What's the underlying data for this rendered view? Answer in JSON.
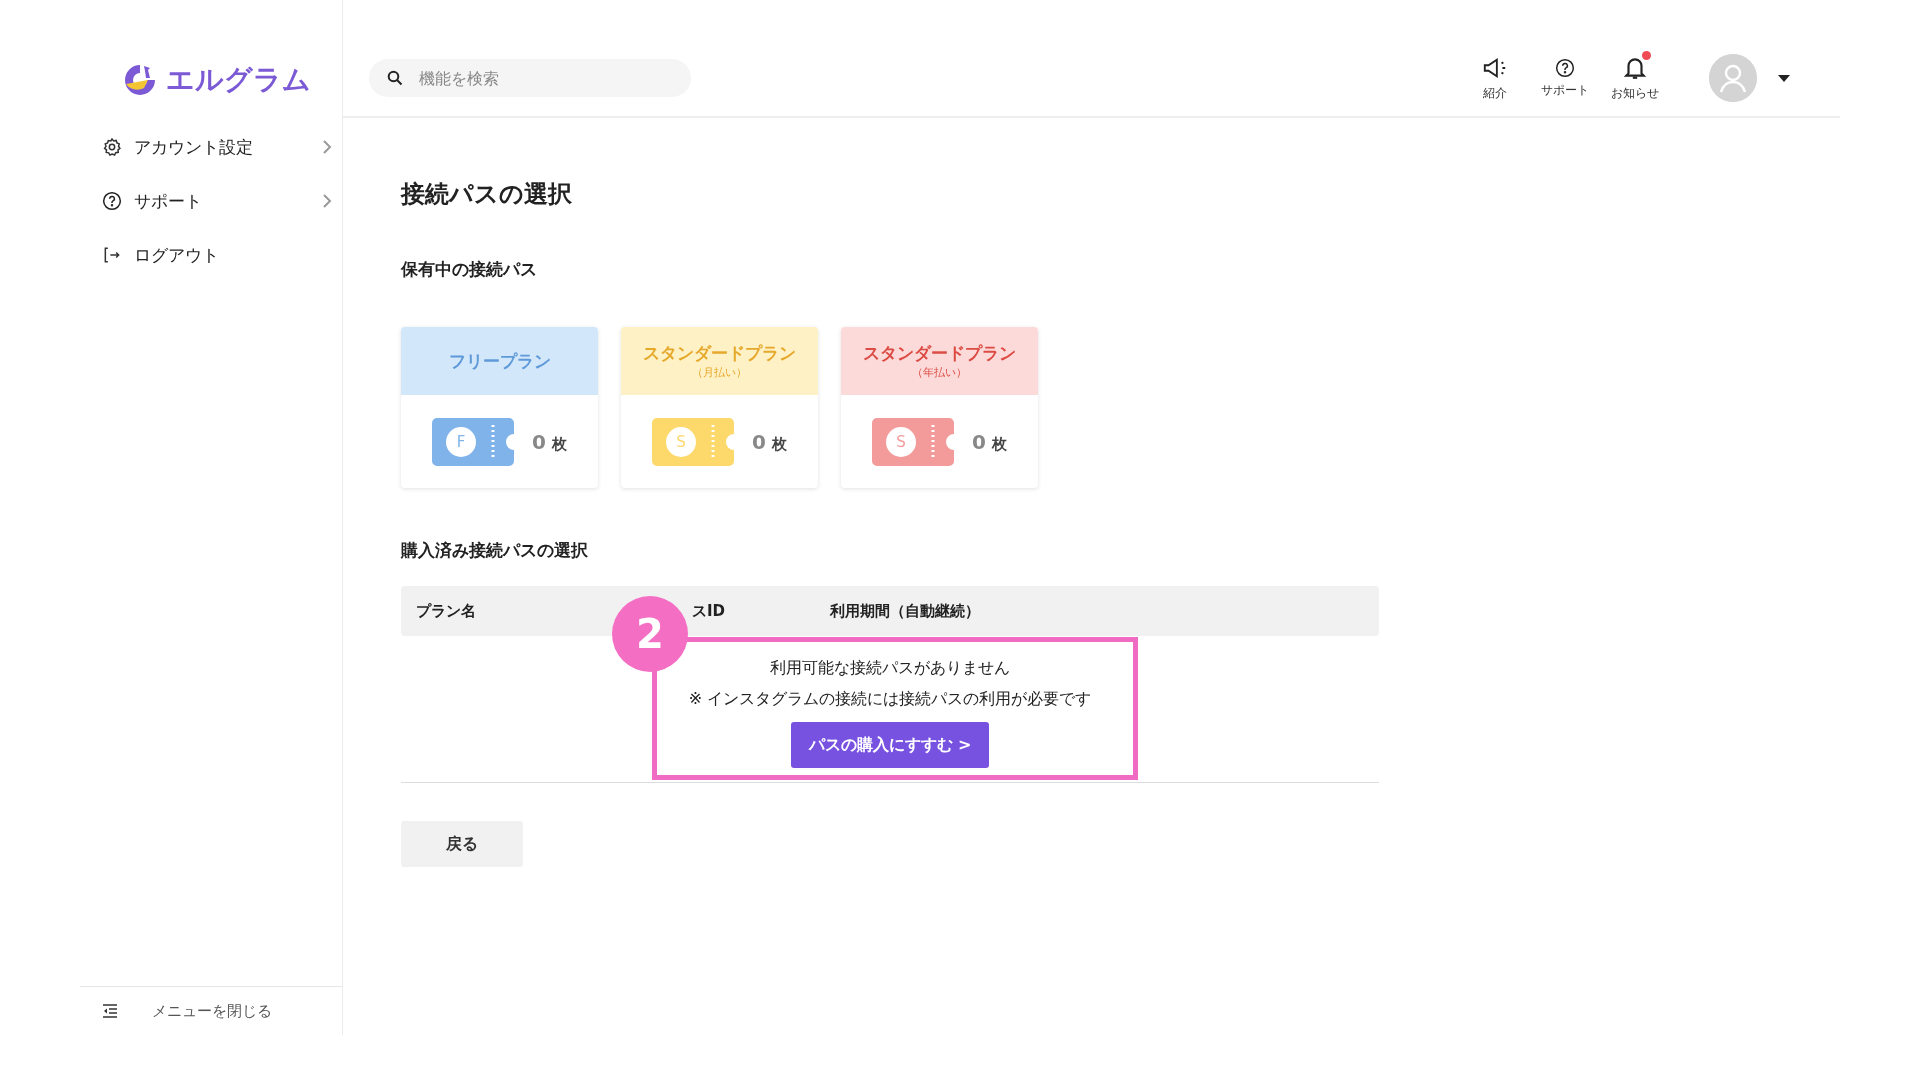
{
  "logo": {
    "text": "エルグラム"
  },
  "search": {
    "placeholder": "機能を検索"
  },
  "sidebar": {
    "items": [
      {
        "label": "アカウント設定",
        "kind": "gear",
        "chevron": true
      },
      {
        "label": "サポート",
        "kind": "help",
        "chevron": true
      },
      {
        "label": "ログアウト",
        "kind": "logout",
        "chevron": false
      }
    ],
    "close_menu": "メニューを閉じる"
  },
  "header_icons": [
    {
      "label": "紹介",
      "kind": "megaphone",
      "notification": false
    },
    {
      "label": "サポート",
      "kind": "help",
      "notification": false
    },
    {
      "label": "お知らせ",
      "kind": "bell",
      "notification": true
    }
  ],
  "page_title": "接続パスの選択",
  "held_section": {
    "title": "保有中の接続パス",
    "cards": [
      {
        "kind": "free",
        "title": "フリープラン",
        "letter": "F",
        "count": "0",
        "unit": "枚",
        "color": "#7fb3ea"
      },
      {
        "kind": "monthly",
        "title": "スタンダードプラン",
        "subtitle": "（月払い）",
        "letter": "S",
        "count": "0",
        "unit": "枚",
        "color": "#fdd86b"
      },
      {
        "kind": "yearly",
        "title": "スタンダードプラン",
        "subtitle": "（年払い）",
        "letter": "S",
        "count": "0",
        "unit": "枚",
        "color": "#f39b9b"
      }
    ]
  },
  "purchased_section": {
    "title": "購入済み接続パスの選択",
    "columns": [
      "プラン名",
      "スID",
      "利用期間（自動継続）"
    ],
    "empty_message": "利用可能な接続パスがありません",
    "note": "※ インスタグラムの接続には接続パスの利用が必要です",
    "buy_button": "パスの購入にすすむ >"
  },
  "annotation": {
    "number": "2"
  },
  "back_button": "戻る"
}
